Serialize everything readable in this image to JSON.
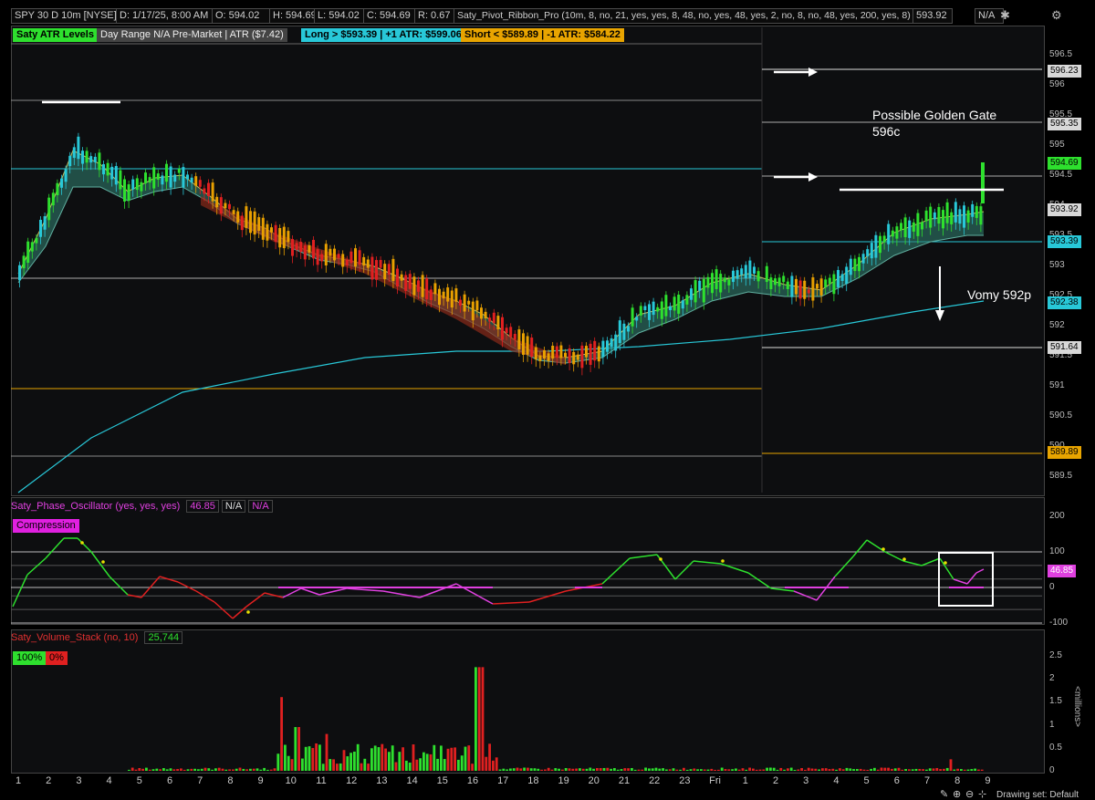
{
  "header": {
    "symbol": "SPY 30 D 10m [NYSE]",
    "date": "D: 1/17/25, 8:00 AM",
    "open": "O: 594.02",
    "high": "H: 594.69",
    "low": "L: 594.02",
    "close": "C: 594.69",
    "range": "R: 0.67",
    "study": "Saty_Pivot_Ribbon_Pro (10m, 8, no, 21, yes, yes, 8, 48, no, yes, 48, yes, 2, no, 8, no, 48, yes, 200, yes, 8)",
    "study_value": "593.92",
    "na": "N/A",
    "icons": [
      "gear-icon",
      "close-icon",
      "settings-gear-icon"
    ]
  },
  "price_panel": {
    "badges": {
      "atr_levels": "Saty ATR Levels",
      "day_range": "Day Range N/A Pre-Market | ATR ($7.42)",
      "long": "Long > $593.39 | +1 ATR: $599.06",
      "short": "Short < $589.89 | -1 ATR: $584.22"
    },
    "annotations": {
      "golden_gate": "Possible Golden Gate\n596c",
      "vomy": "Vomy 592p"
    },
    "scale_ticks": [
      "596.5",
      "596",
      "595.5",
      "595",
      "594.5",
      "594",
      "593.5",
      "593",
      "592.5",
      "592",
      "591.5",
      "591",
      "590.5",
      "590",
      "589.5"
    ],
    "price_tags": [
      {
        "value": "596.23",
        "bg": "#d8d8d8",
        "fg": "#000"
      },
      {
        "value": "595.35",
        "bg": "#d8d8d8",
        "fg": "#000"
      },
      {
        "value": "594.69",
        "bg": "#2ee02e",
        "fg": "#000"
      },
      {
        "value": "593.92",
        "bg": "#d8d8d8",
        "fg": "#000"
      },
      {
        "value": "593.39",
        "bg": "#28c8d8",
        "fg": "#000"
      },
      {
        "value": "592.38",
        "bg": "#28c8d8",
        "fg": "#000"
      },
      {
        "value": "591.64",
        "bg": "#d8d8d8",
        "fg": "#000"
      },
      {
        "value": "589.89",
        "bg": "#e8a400",
        "fg": "#000"
      }
    ]
  },
  "oscillator_panel": {
    "title": "Saty_Phase_Oscillator (yes, yes, yes)",
    "value": "46.85",
    "na1": "N/A",
    "na2": "N/A",
    "compression_label": "Compression",
    "scale_ticks": [
      "200",
      "100",
      "0",
      "-100"
    ],
    "value_tag": "46.85"
  },
  "volume_panel": {
    "title": "Saty_Volume_Stack (no, 10)",
    "value": "25,744",
    "buy_pct": "100%",
    "sell_pct": "0%",
    "scale_ticks": [
      "2.5",
      "2",
      "1.5",
      "1",
      "0.5",
      "0"
    ],
    "unit_label": "<millions>"
  },
  "x_axis": {
    "labels": [
      "1",
      "2",
      "3",
      "4",
      "5",
      "6",
      "7",
      "8",
      "9",
      "10",
      "11",
      "12",
      "13",
      "14",
      "15",
      "16",
      "17",
      "18",
      "19",
      "20",
      "21",
      "22",
      "23",
      "Fri",
      "1",
      "2",
      "3",
      "4",
      "5",
      "6",
      "7",
      "8",
      "9"
    ]
  },
  "footer": {
    "drawing_set": "Drawing set: Default",
    "tool_icons": [
      "pencil-icon",
      "zoom-in-icon",
      "zoom-out-icon",
      "crosshair-icon"
    ]
  },
  "colors": {
    "bull": "#2ee02e",
    "bear": "#e02020",
    "cyan": "#28c8d8",
    "orange": "#e8a400",
    "magenta": "#e040e0"
  }
}
